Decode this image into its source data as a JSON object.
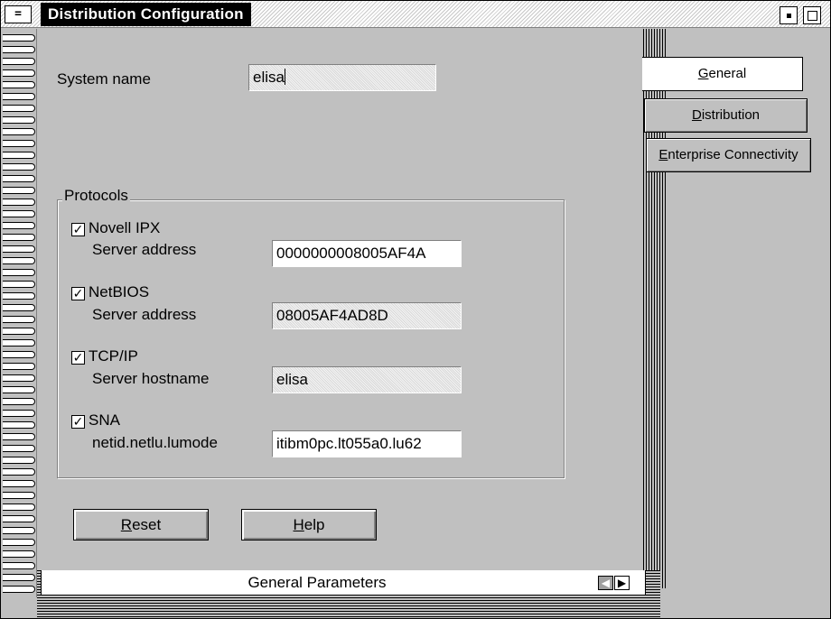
{
  "window": {
    "title": "Distribution Configuration",
    "system_menu_glyph": "=",
    "minimize_icon": "minimize-icon",
    "maximize_icon": "maximize-icon"
  },
  "tabs": [
    {
      "label": "General",
      "mnemonic": "G",
      "rest": "eneral",
      "active": true
    },
    {
      "label": "Distribution",
      "mnemonic": "D",
      "rest": "istribution",
      "active": false
    },
    {
      "label": "Enterprise Connectivity",
      "mnemonic": "E",
      "rest": "nterprise Connectivity",
      "active": false
    }
  ],
  "system": {
    "label": "System name",
    "value": "elisa"
  },
  "protocols": {
    "title": "Protocols",
    "items": [
      {
        "name": "Novell IPX",
        "checked": true,
        "field_label": "Server address",
        "value": "0000000008005AF4A"
      },
      {
        "name": "NetBIOS",
        "checked": true,
        "field_label": "Server address",
        "value": "08005AF4AD8D"
      },
      {
        "name": "TCP/IP",
        "checked": true,
        "field_label": "Server hostname",
        "value": "elisa"
      },
      {
        "name": "SNA",
        "checked": true,
        "field_label": "netid.netlu.lumode",
        "value": "itibm0pc.lt055a0.lu62"
      }
    ]
  },
  "buttons": {
    "reset": {
      "label": "Reset",
      "mnemonic": "R",
      "rest": "eset"
    },
    "help": {
      "label": "Help",
      "mnemonic": "H",
      "rest": "elp"
    }
  },
  "status": {
    "page_title": "General Parameters",
    "prev_icon": "arrow-left-icon",
    "next_icon": "arrow-right-icon"
  },
  "check_glyph": "✓",
  "colors": {
    "title_bar_active": "#000000",
    "face": "#c0c0c0",
    "active_tab": "#ffffff"
  }
}
